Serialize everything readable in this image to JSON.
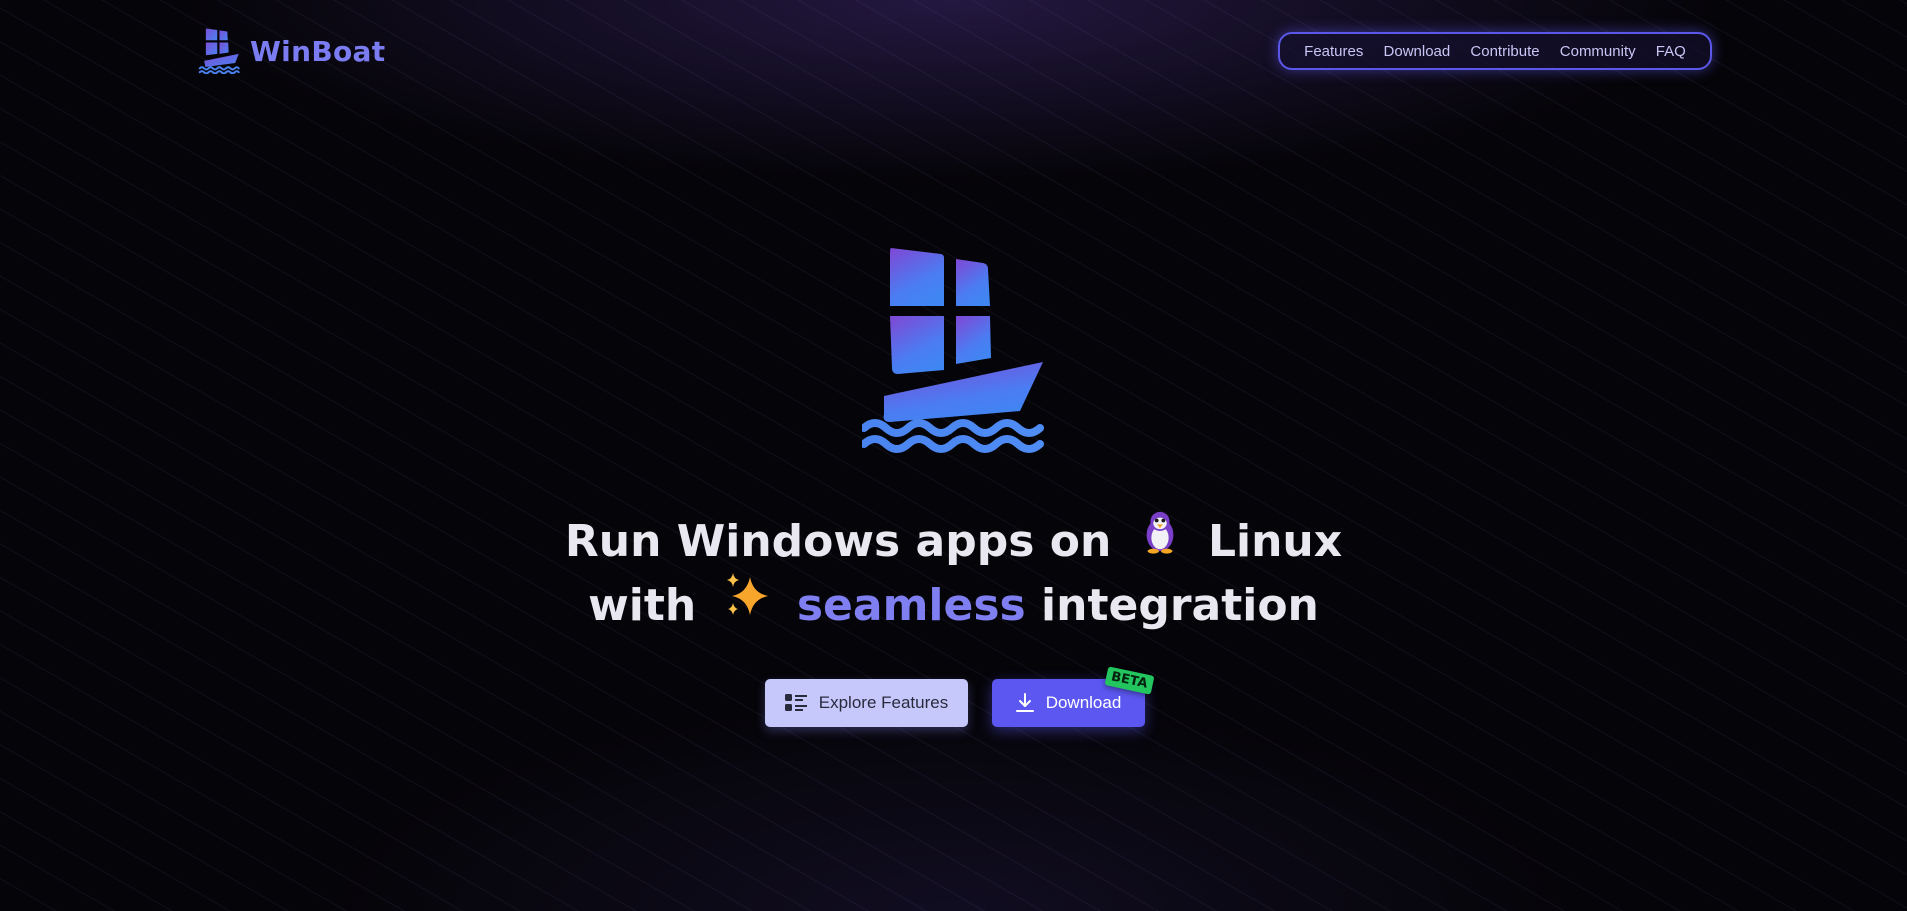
{
  "brand": {
    "name": "WinBoat",
    "logo_icon": "winboat-ship-icon"
  },
  "nav": {
    "items": [
      {
        "label": "Features"
      },
      {
        "label": "Download"
      },
      {
        "label": "Contribute"
      },
      {
        "label": "Community"
      },
      {
        "label": "FAQ"
      }
    ]
  },
  "hero": {
    "logo_icon": "winboat-ship-icon",
    "headline": {
      "part1": "Run Windows apps on",
      "emoji1": "penguin-icon",
      "part2": "Linux",
      "part3": "with",
      "emoji2": "sparkles-icon",
      "accent": "seamless",
      "part4": "integration"
    },
    "buttons": {
      "explore_label": "Explore Features",
      "explore_icon": "list-icon",
      "download_label": "Download",
      "download_icon": "download-icon",
      "download_badge": "BETA"
    }
  },
  "colors": {
    "background": "#050408",
    "accent": "#7b7cf2",
    "primary_button": "#5b57f0",
    "secondary_button": "#c6c8fb",
    "badge": "#23c55e"
  }
}
